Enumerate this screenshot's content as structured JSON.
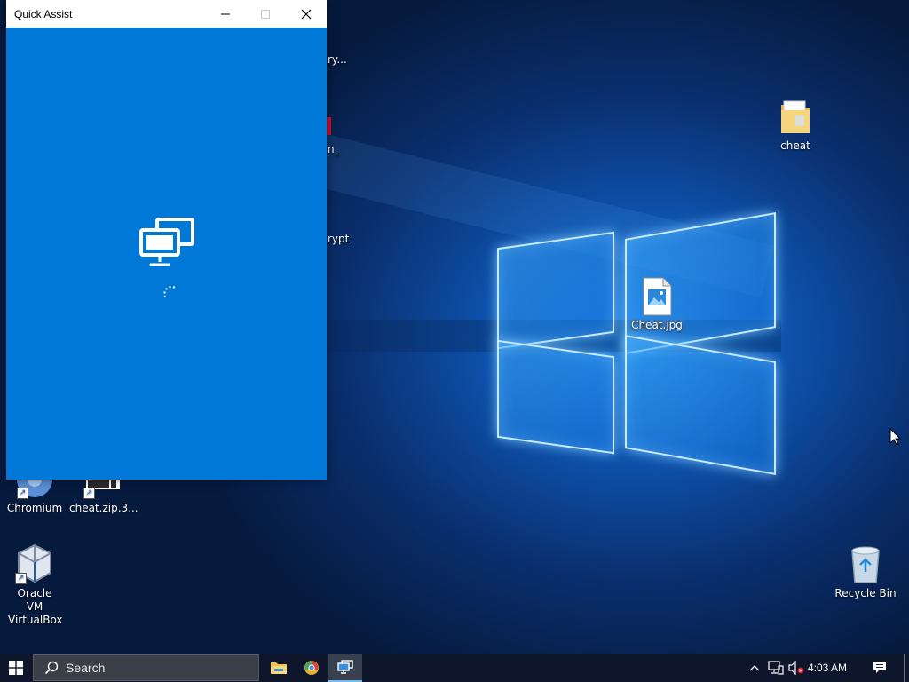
{
  "desktop": {
    "icons": [
      {
        "label": "cheat",
        "icon": "folder-icon"
      },
      {
        "label": "Cheat.jpg",
        "icon": "image-file-icon"
      },
      {
        "label": "Chromium",
        "icon": "chromium-icon"
      },
      {
        "label": "cheat.zip.3...",
        "icon": "zip-file-icon"
      },
      {
        "label": "Oracle VM VirtualBox",
        "icon": "virtualbox-icon"
      },
      {
        "label": "Recycle Bin",
        "icon": "recycle-bin-icon"
      }
    ],
    "partial_labels": [
      "ry...",
      "n_",
      "rypt"
    ]
  },
  "quick_assist": {
    "title": "Quick Assist",
    "background": "#0078d7",
    "status": "loading"
  },
  "taskbar": {
    "search_label": "Search",
    "time": "4:03 AM",
    "pinned": [
      "file-explorer-icon",
      "chromium-icon",
      "quick-assist-icon"
    ],
    "active_app": "quick-assist-icon",
    "tray": [
      "chevron-up-icon",
      "network-icon",
      "volume-muted-icon",
      "notifications-icon"
    ]
  }
}
